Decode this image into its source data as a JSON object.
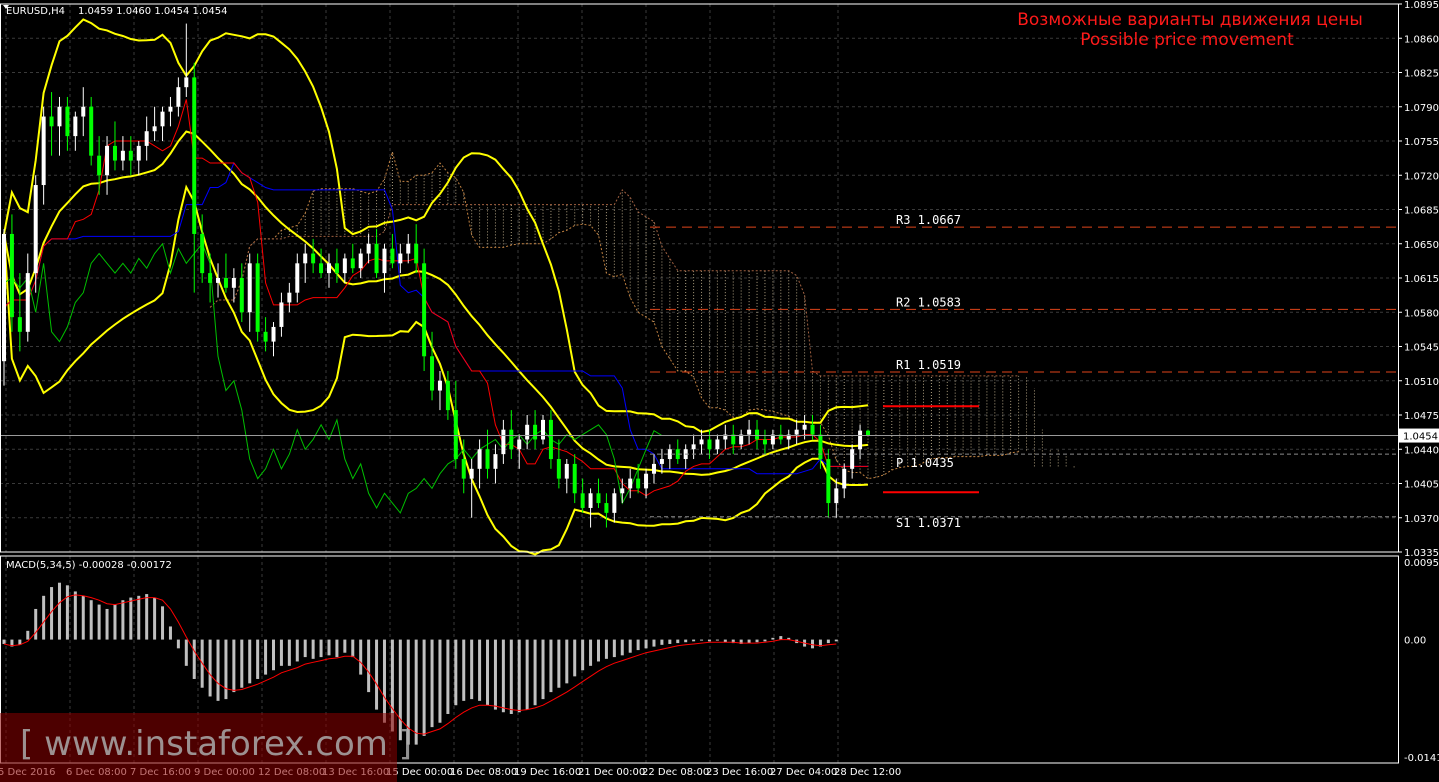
{
  "header": {
    "symbol": "EURUSD,H4",
    "ohlc": "1.0459 1.0460 1.0454 1.0454",
    "macd_label": "MACD(5,34,5) -0.00028 -0.00172"
  },
  "title": {
    "ru": "Возможные варианты движения цены",
    "en": "Possible price movement"
  },
  "watermark": "[ www.instaforex.com ]",
  "colors": {
    "background": "#000000",
    "grid": "#3a3a3a",
    "bull_candle": "#ffffff",
    "bear_candle": "#00ff00",
    "bollinger": "#ffff00",
    "kijun": "#0000ff",
    "tenkan": "#ff0000",
    "chikou": "#00c000",
    "cloud": "#d9c7a0",
    "title": "#ff1a1a",
    "pivot_target": "#ff0000",
    "macd_hist": "#c0c0c0",
    "macd_signal": "#ff0000"
  },
  "chart_data": {
    "type": "candlestick",
    "symbol": "EURUSD",
    "timeframe": "H4",
    "current_price": 1.0454,
    "y_axis_ticks": [
      1.0895,
      1.086,
      1.0825,
      1.079,
      1.0755,
      1.072,
      1.0685,
      1.065,
      1.0615,
      1.058,
      1.0545,
      1.051,
      1.0475,
      1.044,
      1.0405,
      1.037,
      1.0335
    ],
    "ylim": [
      1.0335,
      1.0895
    ],
    "x_axis_labels": [
      "5 Dec 2016",
      "6 Dec 08:00",
      "7 Dec 16:00",
      "9 Dec 00:00",
      "12 Dec 08:00",
      "13 Dec 16:00",
      "15 Dec 00:00",
      "16 Dec 08:00",
      "19 Dec 16:00",
      "21 Dec 00:00",
      "22 Dec 08:00",
      "23 Dec 16:00",
      "27 Dec 04:00",
      "28 Dec 12:00"
    ],
    "pivot_levels": [
      {
        "name": "R3",
        "value": 1.0667,
        "label": "R3  1.0667"
      },
      {
        "name": "R2",
        "value": 1.0583,
        "label": "R2  1.0583"
      },
      {
        "name": "R1",
        "value": 1.0519,
        "label": "R1  1.0519"
      },
      {
        "name": "P",
        "value": 1.0435,
        "label": "P  1.0435"
      },
      {
        "name": "S1",
        "value": 1.0371,
        "label": "S1  1.0371"
      }
    ],
    "target_lines": [
      1.0484,
      1.0396
    ],
    "candles": [
      [
        1.053,
        1.0665,
        1.0505,
        1.066
      ],
      [
        1.066,
        1.068,
        1.056,
        1.0575
      ],
      [
        1.0575,
        1.062,
        1.054,
        1.056
      ],
      [
        1.056,
        1.064,
        1.055,
        1.062
      ],
      [
        1.062,
        1.072,
        1.06,
        1.071
      ],
      [
        1.071,
        1.079,
        1.069,
        1.078
      ],
      [
        1.078,
        1.0805,
        1.074,
        1.077
      ],
      [
        1.077,
        1.08,
        1.074,
        1.079
      ],
      [
        1.079,
        1.08,
        1.0745,
        1.076
      ],
      [
        1.076,
        1.0785,
        1.0745,
        1.078
      ],
      [
        1.078,
        1.081,
        1.076,
        1.079
      ],
      [
        1.079,
        1.08,
        1.073,
        1.074
      ],
      [
        1.074,
        1.076,
        1.07,
        1.072
      ],
      [
        1.072,
        1.076,
        1.07,
        1.075
      ],
      [
        1.075,
        1.0775,
        1.0725,
        1.0735
      ],
      [
        1.0735,
        1.076,
        1.0725,
        1.0745
      ],
      [
        1.0745,
        1.076,
        1.072,
        1.0735
      ],
      [
        1.0735,
        1.0755,
        1.072,
        1.075
      ],
      [
        1.075,
        1.078,
        1.0735,
        1.0765
      ],
      [
        1.0765,
        1.079,
        1.0755,
        1.077
      ],
      [
        1.077,
        1.079,
        1.0755,
        1.0785
      ],
      [
        1.0785,
        1.08,
        1.077,
        1.079
      ],
      [
        1.079,
        1.082,
        1.078,
        1.081
      ],
      [
        1.081,
        1.0875,
        1.08,
        1.082
      ],
      [
        1.082,
        1.0835,
        1.06,
        1.066
      ],
      [
        1.066,
        1.068,
        1.061,
        1.062
      ],
      [
        1.062,
        1.064,
        1.059,
        1.061
      ],
      [
        1.061,
        1.063,
        1.0595,
        1.0615
      ],
      [
        1.0615,
        1.064,
        1.06,
        1.0605
      ],
      [
        1.0605,
        1.0625,
        1.059,
        1.0615
      ],
      [
        1.0615,
        1.063,
        1.057,
        1.058
      ],
      [
        1.058,
        1.064,
        1.056,
        1.063
      ],
      [
        1.063,
        1.064,
        1.055,
        1.056
      ],
      [
        1.056,
        1.0575,
        1.054,
        1.055
      ],
      [
        1.055,
        1.057,
        1.0535,
        1.0565
      ],
      [
        1.0565,
        1.06,
        1.0555,
        1.059
      ],
      [
        1.059,
        1.061,
        1.058,
        1.06
      ],
      [
        1.06,
        1.064,
        1.059,
        1.063
      ],
      [
        1.063,
        1.065,
        1.061,
        1.064
      ],
      [
        1.064,
        1.0655,
        1.062,
        1.063
      ],
      [
        1.063,
        1.0645,
        1.0615,
        1.062
      ],
      [
        1.062,
        1.064,
        1.0605,
        1.063
      ],
      [
        1.063,
        1.0645,
        1.061,
        1.062
      ],
      [
        1.062,
        1.064,
        1.061,
        1.0635
      ],
      [
        1.0635,
        1.065,
        1.062,
        1.0625
      ],
      [
        1.0625,
        1.0645,
        1.0615,
        1.064
      ],
      [
        1.064,
        1.066,
        1.063,
        1.065
      ],
      [
        1.065,
        1.0665,
        1.0615,
        1.062
      ],
      [
        1.062,
        1.065,
        1.06,
        1.0645
      ],
      [
        1.0645,
        1.066,
        1.0625,
        1.063
      ],
      [
        1.063,
        1.065,
        1.062,
        1.064
      ],
      [
        1.064,
        1.066,
        1.063,
        1.065
      ],
      [
        1.065,
        1.067,
        1.062,
        1.063
      ],
      [
        1.063,
        1.0645,
        1.052,
        1.0535
      ],
      [
        1.0535,
        1.056,
        1.049,
        1.05
      ],
      [
        1.05,
        1.052,
        1.048,
        1.051
      ],
      [
        1.051,
        1.052,
        1.047,
        1.048
      ],
      [
        1.048,
        1.051,
        1.042,
        1.043
      ],
      [
        1.043,
        1.045,
        1.0395,
        1.041
      ],
      [
        1.041,
        1.043,
        1.037,
        1.042
      ],
      [
        1.042,
        1.045,
        1.04,
        1.044
      ],
      [
        1.044,
        1.046,
        1.041,
        1.042
      ],
      [
        1.042,
        1.0445,
        1.0405,
        1.0435
      ],
      [
        1.0435,
        1.047,
        1.0425,
        1.046
      ],
      [
        1.046,
        1.048,
        1.043,
        1.044
      ],
      [
        1.044,
        1.0455,
        1.042,
        1.045
      ],
      [
        1.045,
        1.0475,
        1.044,
        1.0465
      ],
      [
        1.0465,
        1.048,
        1.044,
        1.045
      ],
      [
        1.045,
        1.0475,
        1.0445,
        1.047
      ],
      [
        1.047,
        1.048,
        1.042,
        1.043
      ],
      [
        1.043,
        1.045,
        1.04,
        1.041
      ],
      [
        1.041,
        1.043,
        1.0395,
        1.0425
      ],
      [
        1.0425,
        1.0435,
        1.0385,
        1.0395
      ],
      [
        1.0395,
        1.041,
        1.0375,
        1.038
      ],
      [
        1.038,
        1.04,
        1.036,
        1.0395
      ],
      [
        1.0395,
        1.041,
        1.038,
        1.0385
      ],
      [
        1.0385,
        1.0395,
        1.036,
        1.0375
      ],
      [
        1.0375,
        1.04,
        1.0365,
        1.0395
      ],
      [
        1.0395,
        1.041,
        1.0385,
        1.04
      ],
      [
        1.04,
        1.042,
        1.039,
        1.041
      ],
      [
        1.041,
        1.0425,
        1.0395,
        1.04
      ],
      [
        1.04,
        1.042,
        1.039,
        1.0415
      ],
      [
        1.0415,
        1.0435,
        1.0405,
        1.0425
      ],
      [
        1.0425,
        1.044,
        1.0415,
        1.043
      ],
      [
        1.043,
        1.0445,
        1.042,
        1.044
      ],
      [
        1.044,
        1.045,
        1.0425,
        1.043
      ],
      [
        1.043,
        1.0445,
        1.042,
        1.044
      ],
      [
        1.044,
        1.0455,
        1.043,
        1.0445
      ],
      [
        1.0445,
        1.046,
        1.0435,
        1.045
      ],
      [
        1.045,
        1.046,
        1.043,
        1.044
      ],
      [
        1.044,
        1.0455,
        1.0435,
        1.045
      ],
      [
        1.045,
        1.0465,
        1.044,
        1.0455
      ],
      [
        1.0455,
        1.0465,
        1.0435,
        1.0445
      ],
      [
        1.0445,
        1.046,
        1.044,
        1.0455
      ],
      [
        1.0455,
        1.047,
        1.0445,
        1.046
      ],
      [
        1.046,
        1.047,
        1.044,
        1.045
      ],
      [
        1.045,
        1.046,
        1.0435,
        1.0445
      ],
      [
        1.0445,
        1.046,
        1.044,
        1.0455
      ],
      [
        1.0455,
        1.0465,
        1.0445,
        1.045
      ],
      [
        1.045,
        1.046,
        1.044,
        1.0455
      ],
      [
        1.0455,
        1.047,
        1.0445,
        1.046
      ],
      [
        1.046,
        1.0475,
        1.045,
        1.0465
      ],
      [
        1.0465,
        1.0475,
        1.045,
        1.0455
      ],
      [
        1.0455,
        1.0465,
        1.042,
        1.043
      ],
      [
        1.043,
        1.044,
        1.037,
        1.0385
      ],
      [
        1.0385,
        1.041,
        1.037,
        1.04
      ],
      [
        1.04,
        1.0425,
        1.039,
        1.042
      ],
      [
        1.042,
        1.0445,
        1.041,
        1.044
      ],
      [
        1.044,
        1.0465,
        1.043,
        1.0459
      ],
      [
        1.0459,
        1.046,
        1.0454,
        1.0454
      ]
    ],
    "macd_hist": [
      -0.0005,
      -0.0008,
      -0.0006,
      0.001,
      0.0035,
      0.005,
      0.006,
      0.0065,
      0.0062,
      0.0055,
      0.005,
      0.0045,
      0.004,
      0.0035,
      0.004,
      0.0045,
      0.0048,
      0.005,
      0.0052,
      0.0048,
      0.0038,
      0.0015,
      -0.001,
      -0.003,
      -0.0045,
      -0.0055,
      -0.0065,
      -0.007,
      -0.0068,
      -0.006,
      -0.0055,
      -0.005,
      -0.0045,
      -0.004,
      -0.0035,
      -0.003,
      -0.003,
      -0.0025,
      -0.002,
      -0.0022,
      -0.002,
      -0.0018,
      -0.002,
      -0.0015,
      -0.002,
      -0.004,
      -0.006,
      -0.008,
      -0.0095,
      -0.0105,
      -0.0115,
      -0.012,
      -0.012,
      -0.011,
      -0.01,
      -0.0095,
      -0.0085,
      -0.0075,
      -0.007,
      -0.0068,
      -0.007,
      -0.0075,
      -0.008,
      -0.0083,
      -0.0085,
      -0.0083,
      -0.008,
      -0.0075,
      -0.0068,
      -0.006,
      -0.0055,
      -0.005,
      -0.0042,
      -0.0035,
      -0.003,
      -0.0025,
      -0.0022,
      -0.002,
      -0.0018,
      -0.0015,
      -0.0012,
      -0.001,
      -0.0008,
      -0.0006,
      -0.0005,
      -0.0004,
      -0.0003,
      -0.0002,
      -0.0001,
      -0.0002,
      -0.0001,
      -0.0003,
      -0.0004,
      -0.0005,
      -0.0004,
      -0.0003,
      -0.0002,
      0.0002,
      0.0004,
      0.0002,
      -0.0004,
      -0.0008,
      -0.001,
      -0.0008,
      -0.0004,
      -0.0002
    ],
    "macd_signal": [
      -0.0005,
      -0.0007,
      -0.0006,
      -0.0002,
      0.0008,
      0.002,
      0.0032,
      0.0042,
      0.0049,
      0.0051,
      0.005,
      0.0048,
      0.0045,
      0.0041,
      0.004,
      0.0042,
      0.0044,
      0.0046,
      0.0048,
      0.0048,
      0.0045,
      0.0035,
      0.002,
      0.0003,
      -0.0013,
      -0.0027,
      -0.004,
      -0.005,
      -0.0056,
      -0.0058,
      -0.0057,
      -0.0054,
      -0.0051,
      -0.0047,
      -0.0043,
      -0.0038,
      -0.0035,
      -0.0032,
      -0.0028,
      -0.0026,
      -0.0024,
      -0.0022,
      -0.0021,
      -0.0019,
      -0.0019,
      -0.0026,
      -0.0037,
      -0.0051,
      -0.0066,
      -0.0079,
      -0.0091,
      -0.0101,
      -0.0107,
      -0.0108,
      -0.0105,
      -0.0102,
      -0.0096,
      -0.0089,
      -0.0083,
      -0.0078,
      -0.0075,
      -0.0075,
      -0.0076,
      -0.0078,
      -0.008,
      -0.0081,
      -0.008,
      -0.0078,
      -0.0075,
      -0.007,
      -0.0065,
      -0.006,
      -0.0054,
      -0.0048,
      -0.0042,
      -0.0036,
      -0.0031,
      -0.0027,
      -0.0024,
      -0.0021,
      -0.0018,
      -0.0015,
      -0.0013,
      -0.0011,
      -0.0009,
      -0.0007,
      -0.0006,
      -0.0005,
      -0.0004,
      -0.0003,
      -0.0003,
      -0.0003,
      -0.0003,
      -0.0004,
      -0.0004,
      -0.0004,
      -0.0003,
      -0.0002,
      0.0,
      0.0,
      -0.0002,
      -0.0004,
      -0.0006,
      -0.0007,
      -0.0006,
      -0.0005
    ],
    "macd_axis_ticks": [
      "0.00955",
      "0.00",
      "-0.0141"
    ],
    "macd_ylim": [
      -0.0141,
      0.00955
    ]
  }
}
